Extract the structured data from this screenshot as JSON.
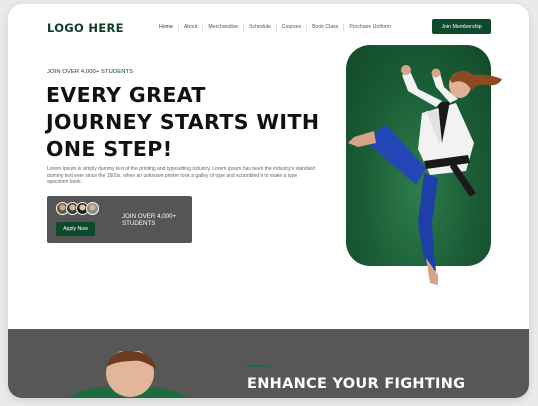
{
  "nav": {
    "logo": "LOGO HERE",
    "items": [
      "Home",
      "About",
      "Merchandise",
      "Schedule",
      "Courses",
      "Book Class",
      "Purchase Uniform"
    ],
    "cta": "Join Membership"
  },
  "hero": {
    "eyebrow": "JOIN OVER 4,000+ STUDENTS",
    "headline": [
      "EVERY GREAT",
      "JOURNEY STARTS WITH",
      "ONE STEP!"
    ],
    "description": "Lorem Ipsum is simply dummy text of the printing and typesetting industry. Lorem Ipsum has been the industry's standard dummy text ever since the 1500s, when an unknown printer took a galley of type and scrambled it to make a type specimen book.",
    "promo_text": "JOIN OVER 4,000+ STUDENTS",
    "apply_label": "Apply Now"
  },
  "band": {
    "heading": "ENHANCE YOUR FIGHTING"
  },
  "colors": {
    "brand_green": "#0d4a2b",
    "band_gray": "#575757",
    "promo_gray": "#555555"
  }
}
